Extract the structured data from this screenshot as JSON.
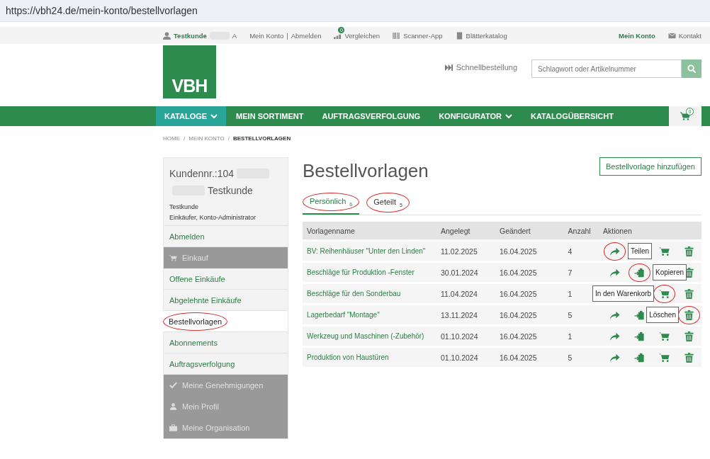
{
  "browser": {
    "url": "https://vbh24.de/mein-konto/bestellvorlagen"
  },
  "utility_bar": {
    "user": "Testkunde",
    "user_suffix": "A",
    "links": [
      "Mein Konto",
      "|",
      "Abmelden"
    ],
    "compare": {
      "label": "Vergleichen",
      "badge": "0"
    },
    "scanner": "Scanner-App",
    "catalog": "Blätterkatalog",
    "account": "Mein Konto",
    "contact": "Kontakt"
  },
  "header": {
    "logo": "VBH",
    "quick_order": "Schnellbestellung",
    "search": {
      "placeholder": "Schlagwort oder Artikelnummer"
    }
  },
  "nav": {
    "items": [
      {
        "label": "KATALOGE",
        "dropdown": true,
        "selected": true
      },
      {
        "label": "MEIN SORTIMENT",
        "dropdown": false,
        "selected": false
      },
      {
        "label": "AUFTRAGSVERFOLGUNG",
        "dropdown": false,
        "selected": false
      },
      {
        "label": "KONFIGURATOR",
        "dropdown": true,
        "selected": false
      },
      {
        "label": "KATALOGÜBERSICHT",
        "dropdown": false,
        "selected": false
      }
    ],
    "cart_badge": "0"
  },
  "breadcrumb": [
    "HOME",
    "/",
    "MEIN KONTO",
    "/",
    "BESTELLVORLAGEN"
  ],
  "sidebar": {
    "customer_no": "Kundennr.:104",
    "customer_name": "Testkunde",
    "user": "Testkunde",
    "roles": "Einkäufer, Konto-Administrator",
    "items": [
      {
        "kind": "link",
        "label": "Abmelden",
        "selected": false,
        "circled": false
      },
      {
        "kind": "section",
        "label": "Einkauf"
      },
      {
        "kind": "link",
        "label": "Offene Einkäufe",
        "selected": false,
        "circled": false
      },
      {
        "kind": "link",
        "label": "Abgelehnte Einkäufe",
        "selected": false,
        "circled": false
      },
      {
        "kind": "link",
        "label": "Bestellvorlagen",
        "selected": true,
        "circled": true
      },
      {
        "kind": "link",
        "label": "Abonnements",
        "selected": false,
        "circled": false
      },
      {
        "kind": "link",
        "label": "Auftragsverfolgung",
        "selected": false,
        "circled": false
      },
      {
        "kind": "section",
        "label": "Meine Genehmigungen"
      },
      {
        "kind": "section",
        "label": "Mein Profil"
      },
      {
        "kind": "section",
        "label": "Meine Organisation"
      }
    ]
  },
  "main": {
    "title": "Bestellvorlagen",
    "add_button": "Bestellvorlage hinzufügen",
    "tabs": [
      {
        "label": "Persönlich",
        "count": "6",
        "selected": true,
        "circled": true
      },
      {
        "label": "Geteilt",
        "count": "5",
        "selected": false,
        "circled": true
      }
    ],
    "table": {
      "columns": [
        "Vorlagenname",
        "Angelegt",
        "Geändert",
        "Anzahl",
        "Aktionen"
      ],
      "rows": [
        {
          "name": "BV: Reihenhäuser \"Unter den Linden\"",
          "created": "11.02.2025",
          "changed": "16.04.2025",
          "count": "4",
          "actions": [
            {
              "kind": "share",
              "callout": "Teilen"
            },
            {
              "kind": "cart"
            },
            {
              "kind": "trash"
            }
          ]
        },
        {
          "name": "Beschläge für Produktion -Fenster",
          "created": "30.01.2024",
          "changed": "16.04.2025",
          "count": "7",
          "actions": [
            {
              "kind": "share"
            },
            {
              "kind": "copy",
              "callout": "Kopieren"
            },
            {
              "kind": "trash"
            }
          ]
        },
        {
          "name": "Beschläge für den Sonderbau",
          "created": "11.04.2024",
          "changed": "16.04.2025",
          "count": "1",
          "actions": [
            {
              "kind": "cart",
              "callout": "In den Warenkorb"
            },
            {
              "kind": "trash"
            }
          ]
        },
        {
          "name": "Lagerbedarf \"Montage\"",
          "created": "13.11.2024",
          "changed": "16.04.2025",
          "count": "5",
          "actions": [
            {
              "kind": "share"
            },
            {
              "kind": "copy"
            },
            {
              "kind": "trash",
              "callout": "Löschen"
            }
          ]
        },
        {
          "name": "Werkzeug und Maschinen (-Zubehör)",
          "created": "01.10.2024",
          "changed": "16.04.2025",
          "count": "1",
          "actions": [
            {
              "kind": "share"
            },
            {
              "kind": "copy"
            },
            {
              "kind": "cart"
            },
            {
              "kind": "trash"
            }
          ]
        },
        {
          "name": "Produktion von Haustüren",
          "created": "01.10.2024",
          "changed": "16.04.2025",
          "count": "5",
          "actions": [
            {
              "kind": "share"
            },
            {
              "kind": "copy"
            },
            {
              "kind": "cart"
            },
            {
              "kind": "trash"
            }
          ]
        }
      ]
    }
  }
}
